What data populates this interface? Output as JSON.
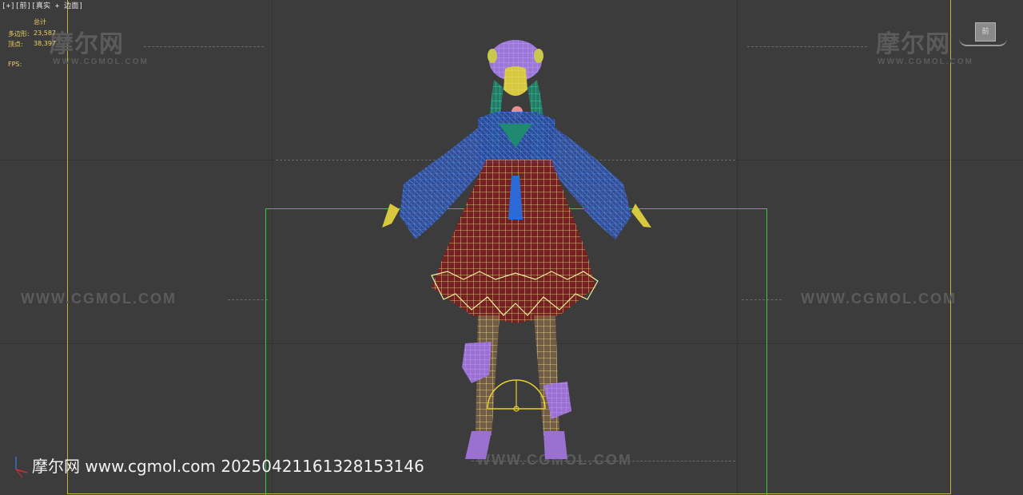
{
  "viewport": {
    "label": "[+][前][真实 + 边面]"
  },
  "stats": {
    "header": "总计",
    "polygons_label": "多边形:",
    "polygons_value": "23,587",
    "vertices_label": "顶点:",
    "vertices_value": "38,397",
    "fps_label": "FPS:"
  },
  "watermark": {
    "brand": "摩尔网",
    "url_small": "WWW.CGMOL.COM",
    "url_long": "WWW.CGMOL.COM"
  },
  "footer": {
    "caption": "摩尔网 www.cgmol.com 20250421161328153146"
  },
  "viewcube": {
    "face_label": "前"
  },
  "colors": {
    "viewport_bg": "#3c3c3c",
    "safe_frame_yellow": "#c8b43c",
    "selection_green": "#3cc83c",
    "wire_yellow": "#e8e890",
    "wire_blue": "#3a6fd0",
    "wire_purple": "#a070e0",
    "wire_teal": "#30c8a0",
    "skirt_red": "#8a1818"
  }
}
